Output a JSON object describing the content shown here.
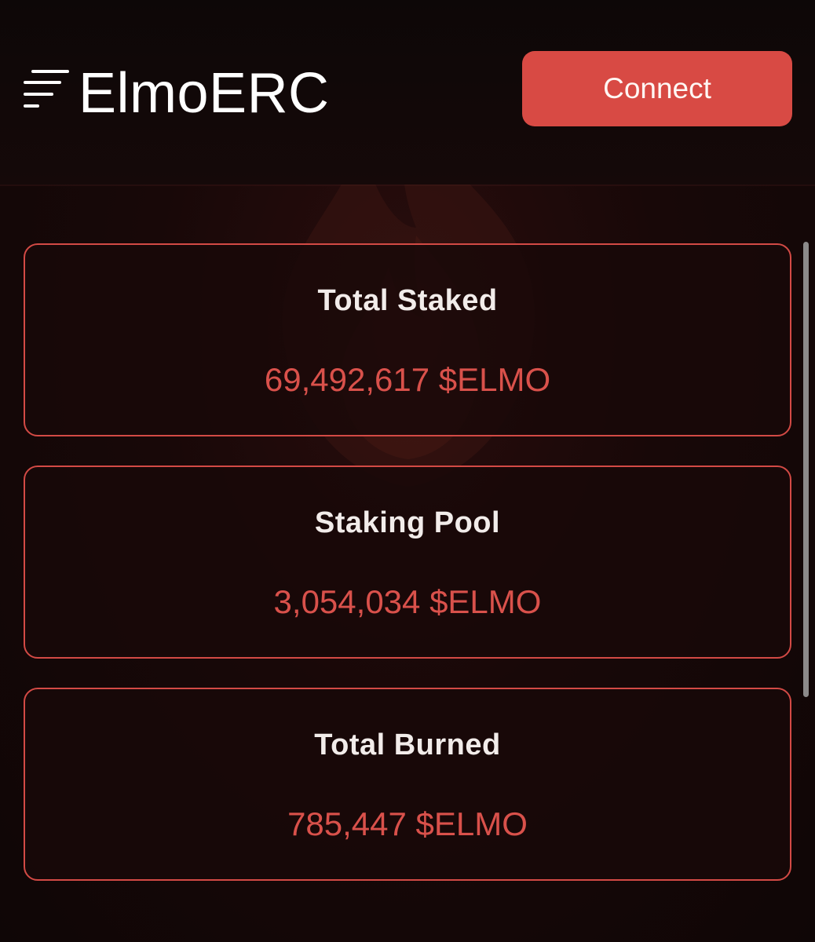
{
  "header": {
    "brand": "ElmoERC",
    "connect_label": "Connect",
    "menu_icon": "hamburger-menu-icon"
  },
  "stats": [
    {
      "label": "Total Staked",
      "value": "69,492,617 $ELMO"
    },
    {
      "label": "Staking Pool",
      "value": "3,054,034 $ELMO"
    },
    {
      "label": "Total Burned",
      "value": "785,447 $ELMO"
    }
  ],
  "colors": {
    "accent": "#d84a44",
    "value_text": "#d9514b",
    "background": "#120708"
  }
}
